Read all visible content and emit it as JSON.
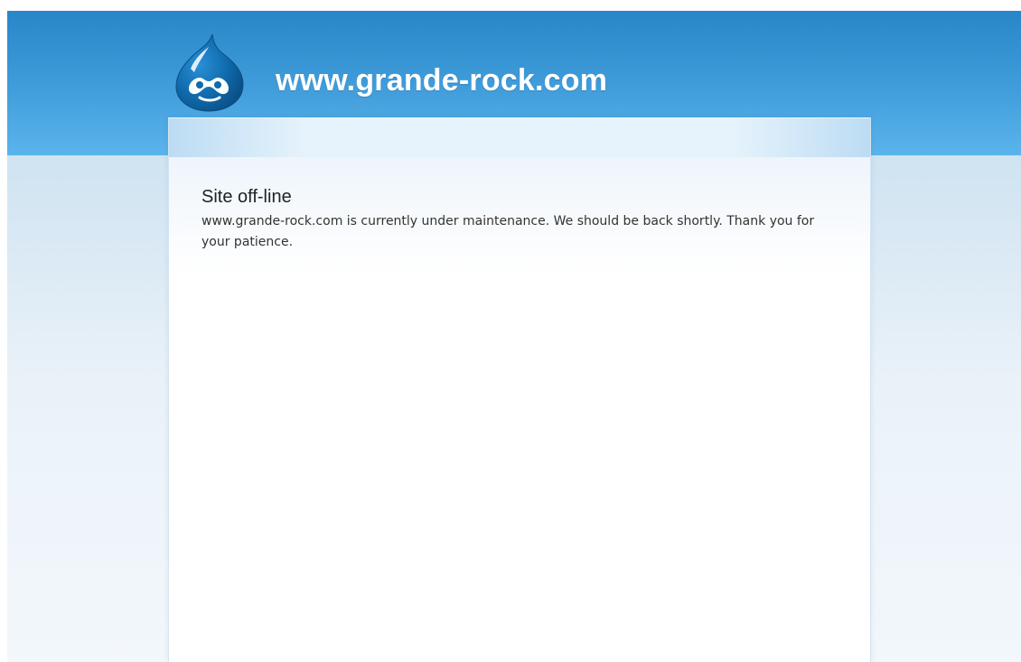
{
  "header": {
    "site_name": "www.grande-rock.com",
    "logo_icon": "drupal-drop-icon"
  },
  "main": {
    "title": "Site off-line",
    "message": "www.grande-rock.com is currently under maintenance. We should be back shortly. Thank you for your patience."
  },
  "colors": {
    "header_top": "#2886c9",
    "header_bottom": "#5ab4ec",
    "page_background": "#e8f1f8",
    "logo_blue": "#0f6aac",
    "site_name_text": "#ffffff",
    "title_text": "#222222",
    "body_text": "#333333"
  }
}
